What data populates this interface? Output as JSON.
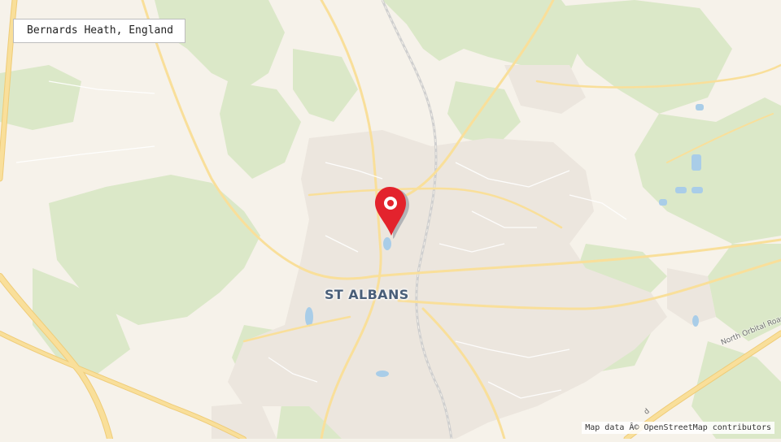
{
  "location": {
    "name": "Bernards Heath, England"
  },
  "map": {
    "city_label": "ST ALBANS",
    "road_label": "North Orbital Road",
    "road_label_partial": "d",
    "attribution": "Map data Â© OpenStreetMap contributors"
  },
  "colors": {
    "background": "#f6f2ea",
    "park": "#dbe8c8",
    "urban": "#ece6de",
    "road_major": "#f9df9a",
    "water": "#a9cde8",
    "marker": "#e3232d",
    "city_text": "#4a5f79"
  },
  "icons": {
    "marker": "map-pin-icon"
  }
}
